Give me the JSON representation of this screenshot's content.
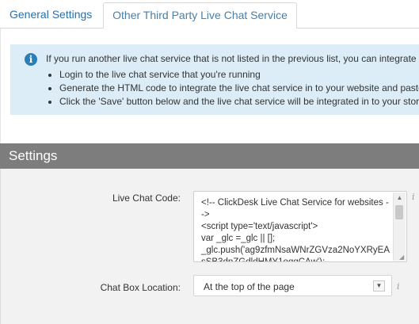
{
  "tabs": [
    {
      "label": "General Settings"
    },
    {
      "label": "Other Third Party Live Chat Service"
    }
  ],
  "info": {
    "icon": "info-icon",
    "text": "If you run another live chat service that is not listed in the previous list, you can integrate",
    "items": [
      "Login to the live chat service that you're running",
      "Generate the HTML code to integrate the live chat service in to your website and paste",
      "Click the 'Save' button below and the live chat service will be integrated in to your store"
    ]
  },
  "settings": {
    "title": "Settings",
    "live_chat_code": {
      "label": "Live Chat Code:",
      "value": "<!-- ClickDesk Live Chat Service for websites -->\n<script type='text/javascript'>\nvar _glc =_glc || [];\n_glc.push('ag9zfmNsaWNrZGVza2NoYXRyEAsSB3dpZGdldHMY1oqqCAw');"
    },
    "chat_box_location": {
      "label": "Chat Box Location:",
      "value": "At the top of the page"
    },
    "help_glyph": "i"
  },
  "colors": {
    "tab_text": "#2a6fa8",
    "info_bg": "#dcedf7",
    "info_icon": "#2b7fb6",
    "settings_header_bg": "#7d7d7d",
    "settings_body_bg": "#f2f2f2"
  }
}
